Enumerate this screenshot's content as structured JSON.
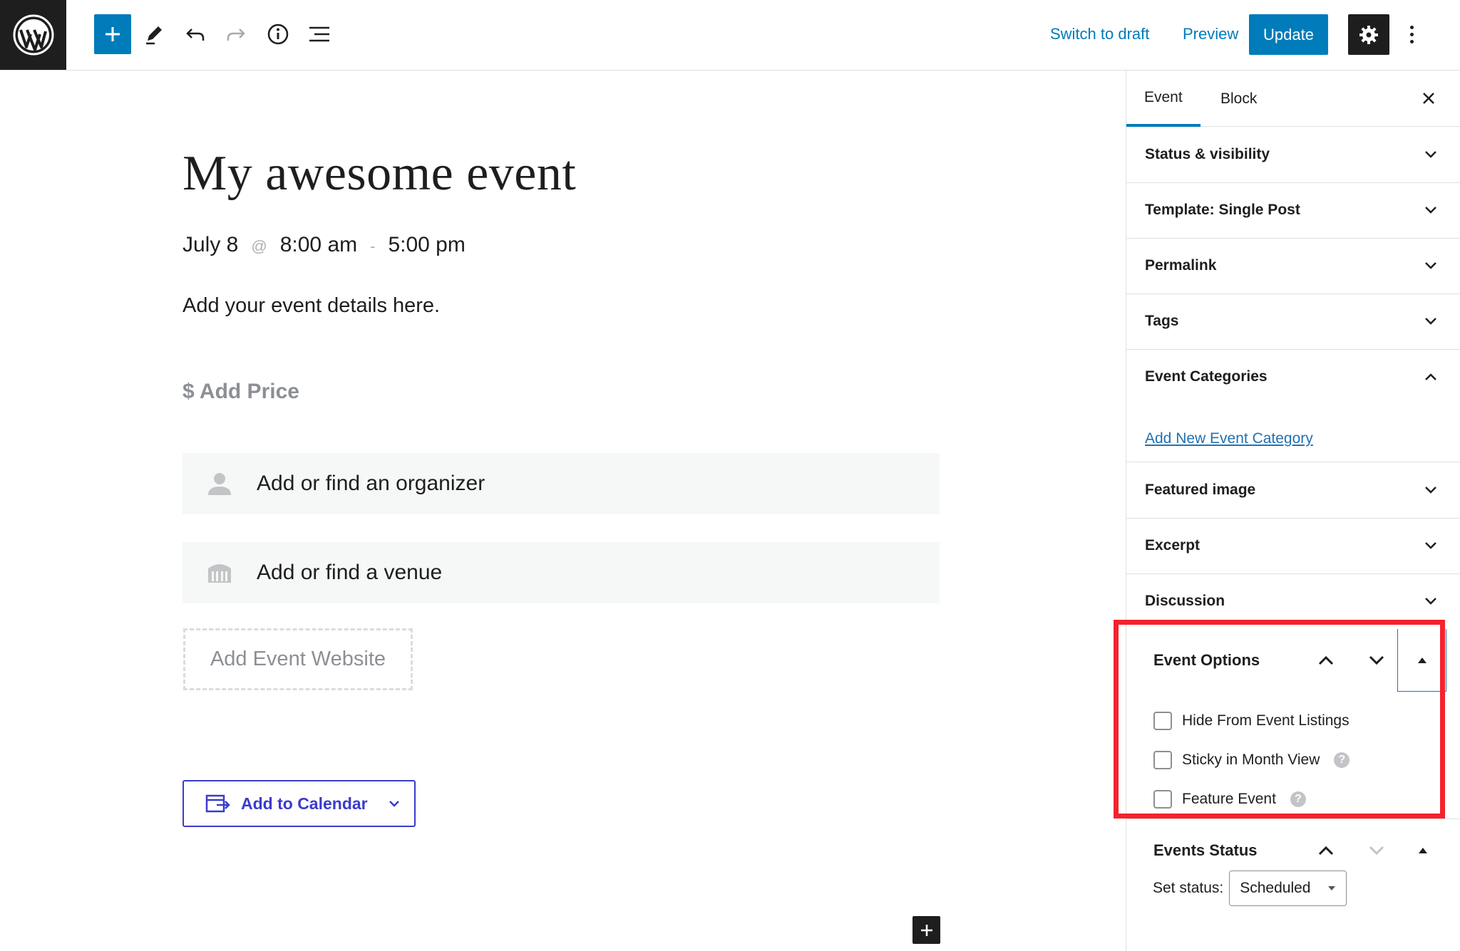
{
  "toolbar": {
    "switch_to_draft": "Switch to draft",
    "preview": "Preview",
    "update": "Update",
    "icons": [
      "wordpress-logo-icon",
      "plus-icon",
      "pencil-icon",
      "undo-icon",
      "redo-icon",
      "info-icon",
      "list-view-icon",
      "gear-icon",
      "kebab-menu-icon"
    ]
  },
  "post": {
    "title": "My awesome event",
    "date": "July 8",
    "at_symbol": "@",
    "start_time": "8:00 am",
    "dash": "-",
    "end_time": "5:00 pm",
    "details_placeholder": "Add your event details here.",
    "price_placeholder": "$ Add Price",
    "organizer_placeholder": "Add or find an organizer",
    "venue_placeholder": "Add or find a venue",
    "website_placeholder": "Add Event Website",
    "add_to_calendar": "Add to Calendar"
  },
  "sidebar": {
    "tabs": [
      {
        "label": "Event",
        "active": true
      },
      {
        "label": "Block",
        "active": false
      }
    ],
    "panels": [
      {
        "label": "Status & visibility",
        "expanded": false
      },
      {
        "label": "Template: Single Post",
        "expanded": false
      },
      {
        "label": "Permalink",
        "expanded": false
      },
      {
        "label": "Tags",
        "expanded": false
      },
      {
        "label": "Event Categories",
        "expanded": true
      },
      {
        "label": "Featured image",
        "expanded": false
      },
      {
        "label": "Excerpt",
        "expanded": false
      },
      {
        "label": "Discussion",
        "expanded": false
      }
    ],
    "event_categories_link": "Add New Event Category",
    "event_options": {
      "title": "Event Options",
      "options": [
        {
          "label": "Hide From Event Listings",
          "checked": false,
          "help": false
        },
        {
          "label": "Sticky in Month View",
          "checked": false,
          "help": true
        },
        {
          "label": "Feature Event",
          "checked": false,
          "help": true
        }
      ]
    },
    "events_status": {
      "title": "Events Status",
      "set_status_label": "Set status:",
      "selected": "Scheduled"
    }
  },
  "colors": {
    "accent": "#007cba",
    "highlight": "#f5222d",
    "calendar_button": "#3a3bcb"
  }
}
